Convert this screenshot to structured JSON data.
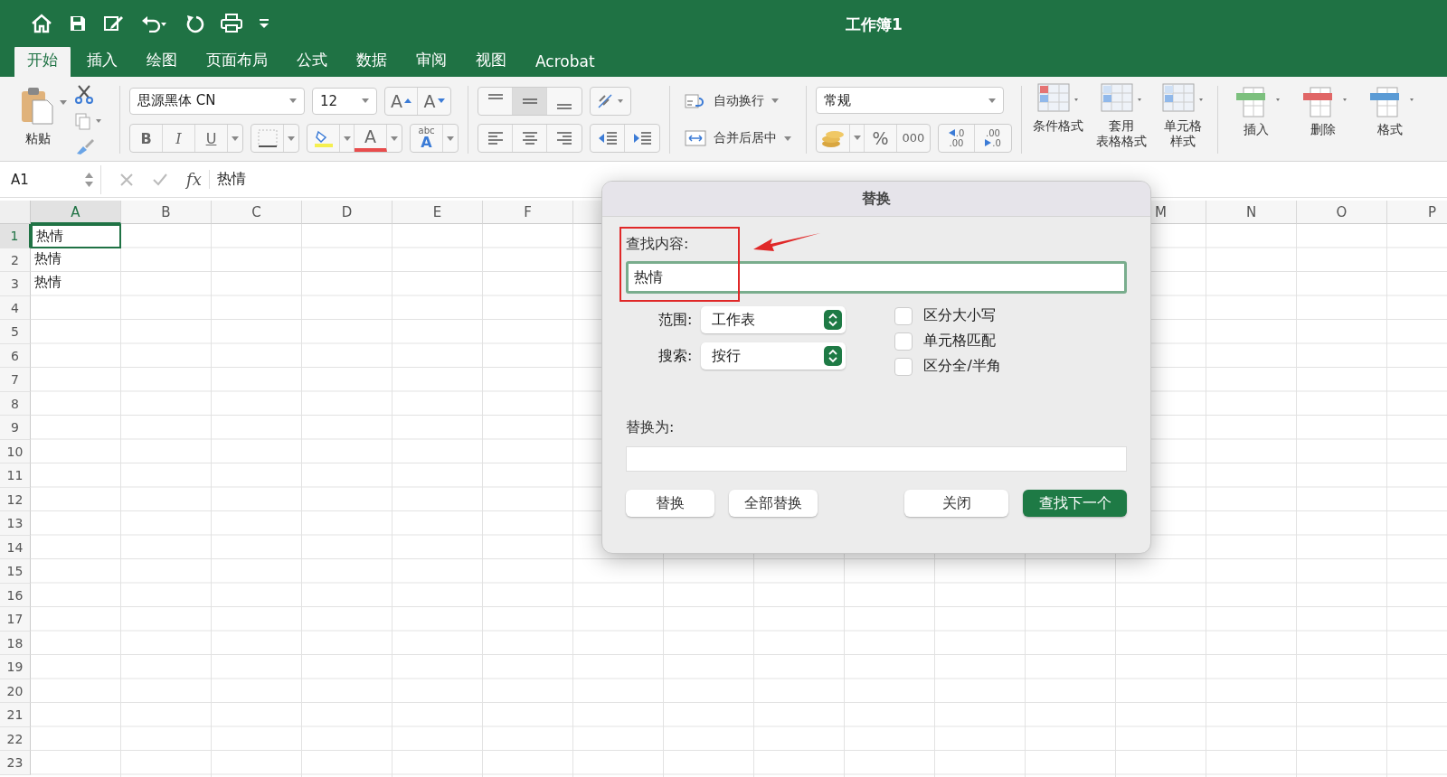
{
  "window": {
    "title": "工作簿1"
  },
  "tabs": [
    {
      "label": "开始",
      "selected": true
    },
    {
      "label": "插入",
      "selected": false
    },
    {
      "label": "绘图",
      "selected": false
    },
    {
      "label": "页面布局",
      "selected": false
    },
    {
      "label": "公式",
      "selected": false
    },
    {
      "label": "数据",
      "selected": false
    },
    {
      "label": "审阅",
      "selected": false
    },
    {
      "label": "视图",
      "selected": false
    },
    {
      "label": "Acrobat",
      "selected": false
    }
  ],
  "ribbon": {
    "paste_label": "粘贴",
    "font_name": "思源黑体 CN",
    "font_size": "12",
    "grow_glyph": "A",
    "shrink_glyph": "A",
    "bold": "B",
    "italic": "I",
    "underline": "U",
    "font_color_glyph": "A",
    "phonetic_top": "abc",
    "phonetic_bottom": "A",
    "wrap_text": "自动换行",
    "merge_center": "合并后居中",
    "number_format": "常规",
    "percent": "%",
    "thousands": "000",
    "increase_decimal": [
      ".0",
      ".00"
    ],
    "decrease_decimal": [
      ".00",
      ".0"
    ],
    "styles": [
      {
        "lines": [
          "条件格式"
        ]
      },
      {
        "lines": [
          "套用",
          "表格格式"
        ]
      },
      {
        "lines": [
          "单元格",
          "样式"
        ]
      }
    ],
    "cells": [
      {
        "label": "插入"
      },
      {
        "label": "删除"
      },
      {
        "label": "格式"
      }
    ]
  },
  "formula_bar": {
    "name_box": "A1",
    "fx": "fx",
    "value": "热情"
  },
  "sheet": {
    "columns_left": [
      {
        "label": "A",
        "selected": true
      },
      {
        "label": "B",
        "selected": false
      },
      {
        "label": "C",
        "selected": false
      },
      {
        "label": "D",
        "selected": false
      },
      {
        "label": "E",
        "selected": false
      },
      {
        "label": "F",
        "selected": false
      }
    ],
    "columns_right": [
      {
        "label": "M",
        "selected": false
      },
      {
        "label": "N",
        "selected": false
      },
      {
        "label": "O",
        "selected": false
      },
      {
        "label": "P",
        "selected": false
      }
    ],
    "rows": [
      {
        "number": "1",
        "selected": true,
        "a": "热情"
      },
      {
        "number": "2",
        "selected": false,
        "a": "热情"
      },
      {
        "number": "3",
        "selected": false,
        "a": "热情"
      },
      {
        "number": "4",
        "selected": false
      },
      {
        "number": "5",
        "selected": false
      },
      {
        "number": "6",
        "selected": false
      },
      {
        "number": "7",
        "selected": false
      },
      {
        "number": "8",
        "selected": false
      },
      {
        "number": "9",
        "selected": false
      },
      {
        "number": "10",
        "selected": false
      },
      {
        "number": "11",
        "selected": false
      },
      {
        "number": "12",
        "selected": false
      },
      {
        "number": "13",
        "selected": false
      },
      {
        "number": "14",
        "selected": false
      },
      {
        "number": "15",
        "selected": false
      },
      {
        "number": "16",
        "selected": false
      },
      {
        "number": "17",
        "selected": false
      },
      {
        "number": "18",
        "selected": false
      },
      {
        "number": "19",
        "selected": false
      },
      {
        "number": "20",
        "selected": false
      },
      {
        "number": "21",
        "selected": false
      },
      {
        "number": "22",
        "selected": false
      },
      {
        "number": "23",
        "selected": false
      }
    ]
  },
  "dialog": {
    "title": "替换",
    "find_label": "查找内容:",
    "find_value": "热情",
    "scope_label": "范围:",
    "scope_value": "工作表",
    "search_label": "搜索:",
    "search_value": "按行",
    "options": [
      {
        "label": "区分大小写",
        "checked": false
      },
      {
        "label": "单元格匹配",
        "checked": false
      },
      {
        "label": "区分全/半角",
        "checked": false
      }
    ],
    "replace_label": "替换为:",
    "buttons_left": [
      {
        "label": "替换",
        "kind": "normal"
      },
      {
        "label": "全部替换",
        "kind": "normal"
      }
    ],
    "buttons_right": [
      {
        "label": "关闭",
        "kind": "normal"
      },
      {
        "label": "查找下一个",
        "kind": "primary"
      }
    ]
  }
}
